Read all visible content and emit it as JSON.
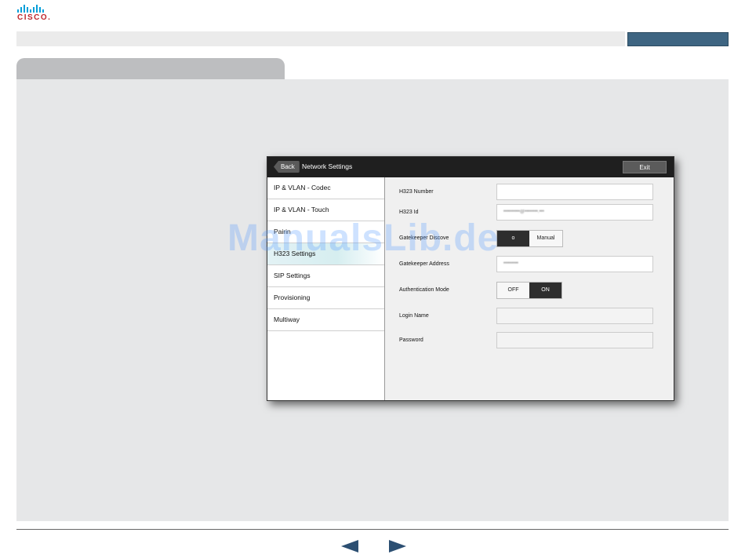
{
  "logo": {
    "text": "CISCO."
  },
  "device": {
    "back_label": "Back",
    "title": "Network Settings",
    "exit_label": "Exit",
    "sidebar_items": [
      {
        "label": "IP & VLAN - Codec"
      },
      {
        "label": "IP & VLAN - Touch"
      },
      {
        "label": "Pairin"
      },
      {
        "label": "H323 Settings"
      },
      {
        "label": "SIP Settings"
      },
      {
        "label": "Provisioning"
      },
      {
        "label": "Multiway"
      }
    ],
    "fields": {
      "h323_number": {
        "label": "H323 Number",
        "value": ""
      },
      "h323_id": {
        "label": "H323 Id",
        "value": "••••••••••@••••••••.•••"
      },
      "gatekeeper_discovery": {
        "label": "Gatekeeper Discove",
        "option_auto": "o",
        "option_manual": "Manual"
      },
      "gatekeeper_address": {
        "label": "Gatekeeper Address",
        "value": "•••••••••"
      },
      "authentication_mode": {
        "label": "Authentication Mode",
        "option_off": "OFF",
        "option_on": "ON",
        "selected": "ON"
      },
      "login_name": {
        "label": "Login Name",
        "value": ""
      },
      "password": {
        "label": "Password",
        "value": ""
      }
    }
  },
  "watermark": "ManualsLib.de",
  "navigation": {
    "prev_icon": "triangle-left",
    "next_icon": "triangle-right"
  }
}
